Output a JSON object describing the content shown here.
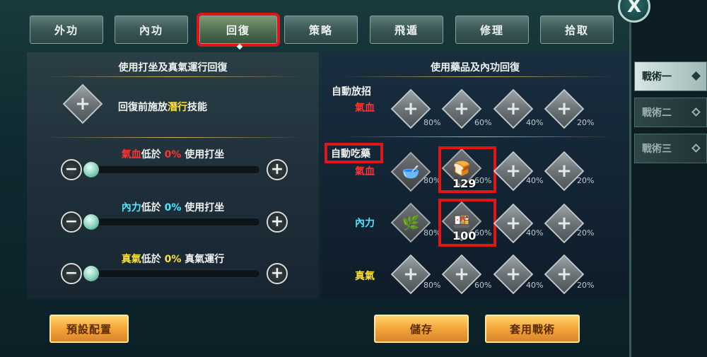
{
  "tabs": [
    "外功",
    "內功",
    "回復",
    "策略",
    "飛遁",
    "修理",
    "拾取"
  ],
  "active_tab_index": 2,
  "close_label": "X",
  "left": {
    "title": "使用打坐及真氣運行回復",
    "pre_skill": {
      "prefix": "回復前施放",
      "highlight": "潛行",
      "suffix": "技能"
    },
    "sliders": [
      {
        "name_part": "氣血",
        "mid": "低於 ",
        "value": "0%",
        "action": " 使用打坐",
        "color": "red",
        "level": 0
      },
      {
        "name_part": "內力",
        "mid": "低於 ",
        "value": "0%",
        "action": " 使用打坐",
        "color": "cyan",
        "level": 0
      },
      {
        "name_part": "真氣",
        "mid": "低於 ",
        "value": "0%",
        "action": " 真氣運行",
        "color": "yellow",
        "level": 0
      }
    ]
  },
  "right": {
    "title": "使用藥品及內功回復",
    "auto_skill_label": "自動放招",
    "auto_skill_sub": "氣血",
    "auto_potion_label": "自動吃藥",
    "rows": [
      {
        "label": "氣血",
        "color": "red"
      },
      {
        "label": "內力",
        "color": "cyan"
      },
      {
        "label": "真氣",
        "color": "yellow"
      }
    ],
    "percents": [
      "80%",
      "60%",
      "40%",
      "20%"
    ],
    "item_counts": {
      "hp_60": "129",
      "mp_60": "100"
    }
  },
  "buttons": {
    "preset": "預設配置",
    "save": "儲存",
    "apply": "套用戰術"
  },
  "side_tabs": [
    "戰術一",
    "戰術二",
    "戰術三"
  ],
  "active_side_tab": 0
}
